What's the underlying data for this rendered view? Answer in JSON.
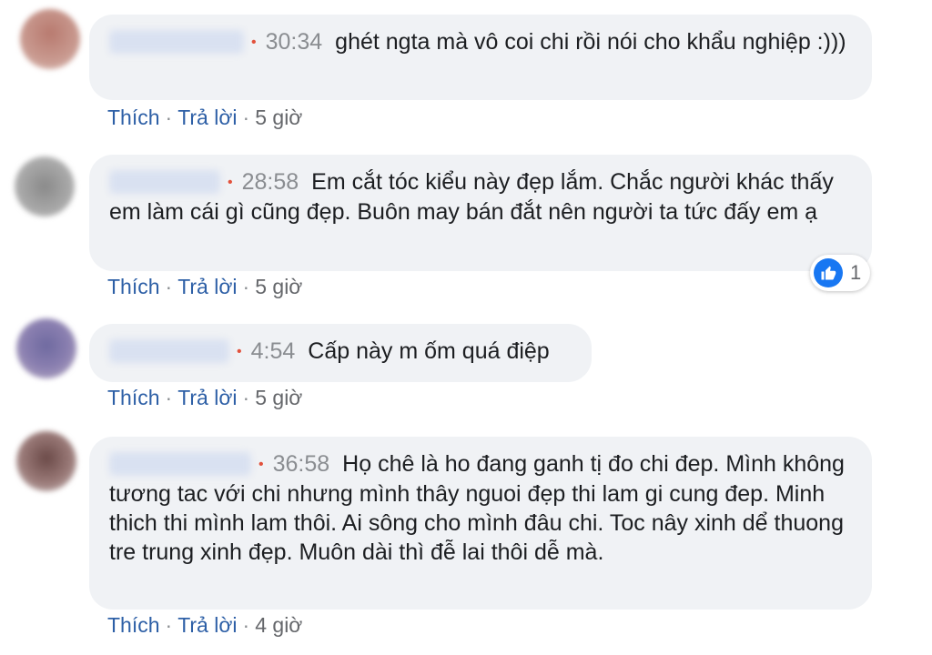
{
  "comments": [
    {
      "time": "30:34",
      "text": "ghét ngta mà vô coi chi rồi nói cho khẩu nghiệp :)))",
      "like": "Thích",
      "reply": "Trả lời",
      "age": "5 giờ"
    },
    {
      "time": "28:58",
      "text": "Em cắt tóc kiểu này đẹp lắm. Chắc người khác thấy em làm cái gì cũng đẹp. Buôn may bán đắt nên người ta tức đấy em ạ",
      "like": "Thích",
      "reply": "Trả lời",
      "age": "5 giờ",
      "reaction_count": "1"
    },
    {
      "time": "4:54",
      "text": "Cấp này m ốm quá điệp",
      "like": "Thích",
      "reply": "Trả lời",
      "age": "5 giờ"
    },
    {
      "time": "36:58",
      "text": "Họ chê là ho đang ganh tị đo chi đep. Mình không tương tac với chi nhưng mình thây nguoi đẹp thi lam gi cung đep. Minh thich thi mình lam thôi. Ai sông cho mình đâu chi. Toc nây xinh dể thuong tre trung xinh đẹp. Muôn dài thì đễ lai thôi dễ mà.",
      "like": "Thích",
      "reply": "Trả lời",
      "age": "4 giờ"
    }
  ],
  "separator": "·",
  "colors": {
    "link": "#2d5fa6",
    "bubble": "#f0f2f5",
    "dot": "#e2513c",
    "like": "#1877f2"
  },
  "icons": {
    "reaction": "like-icon"
  }
}
